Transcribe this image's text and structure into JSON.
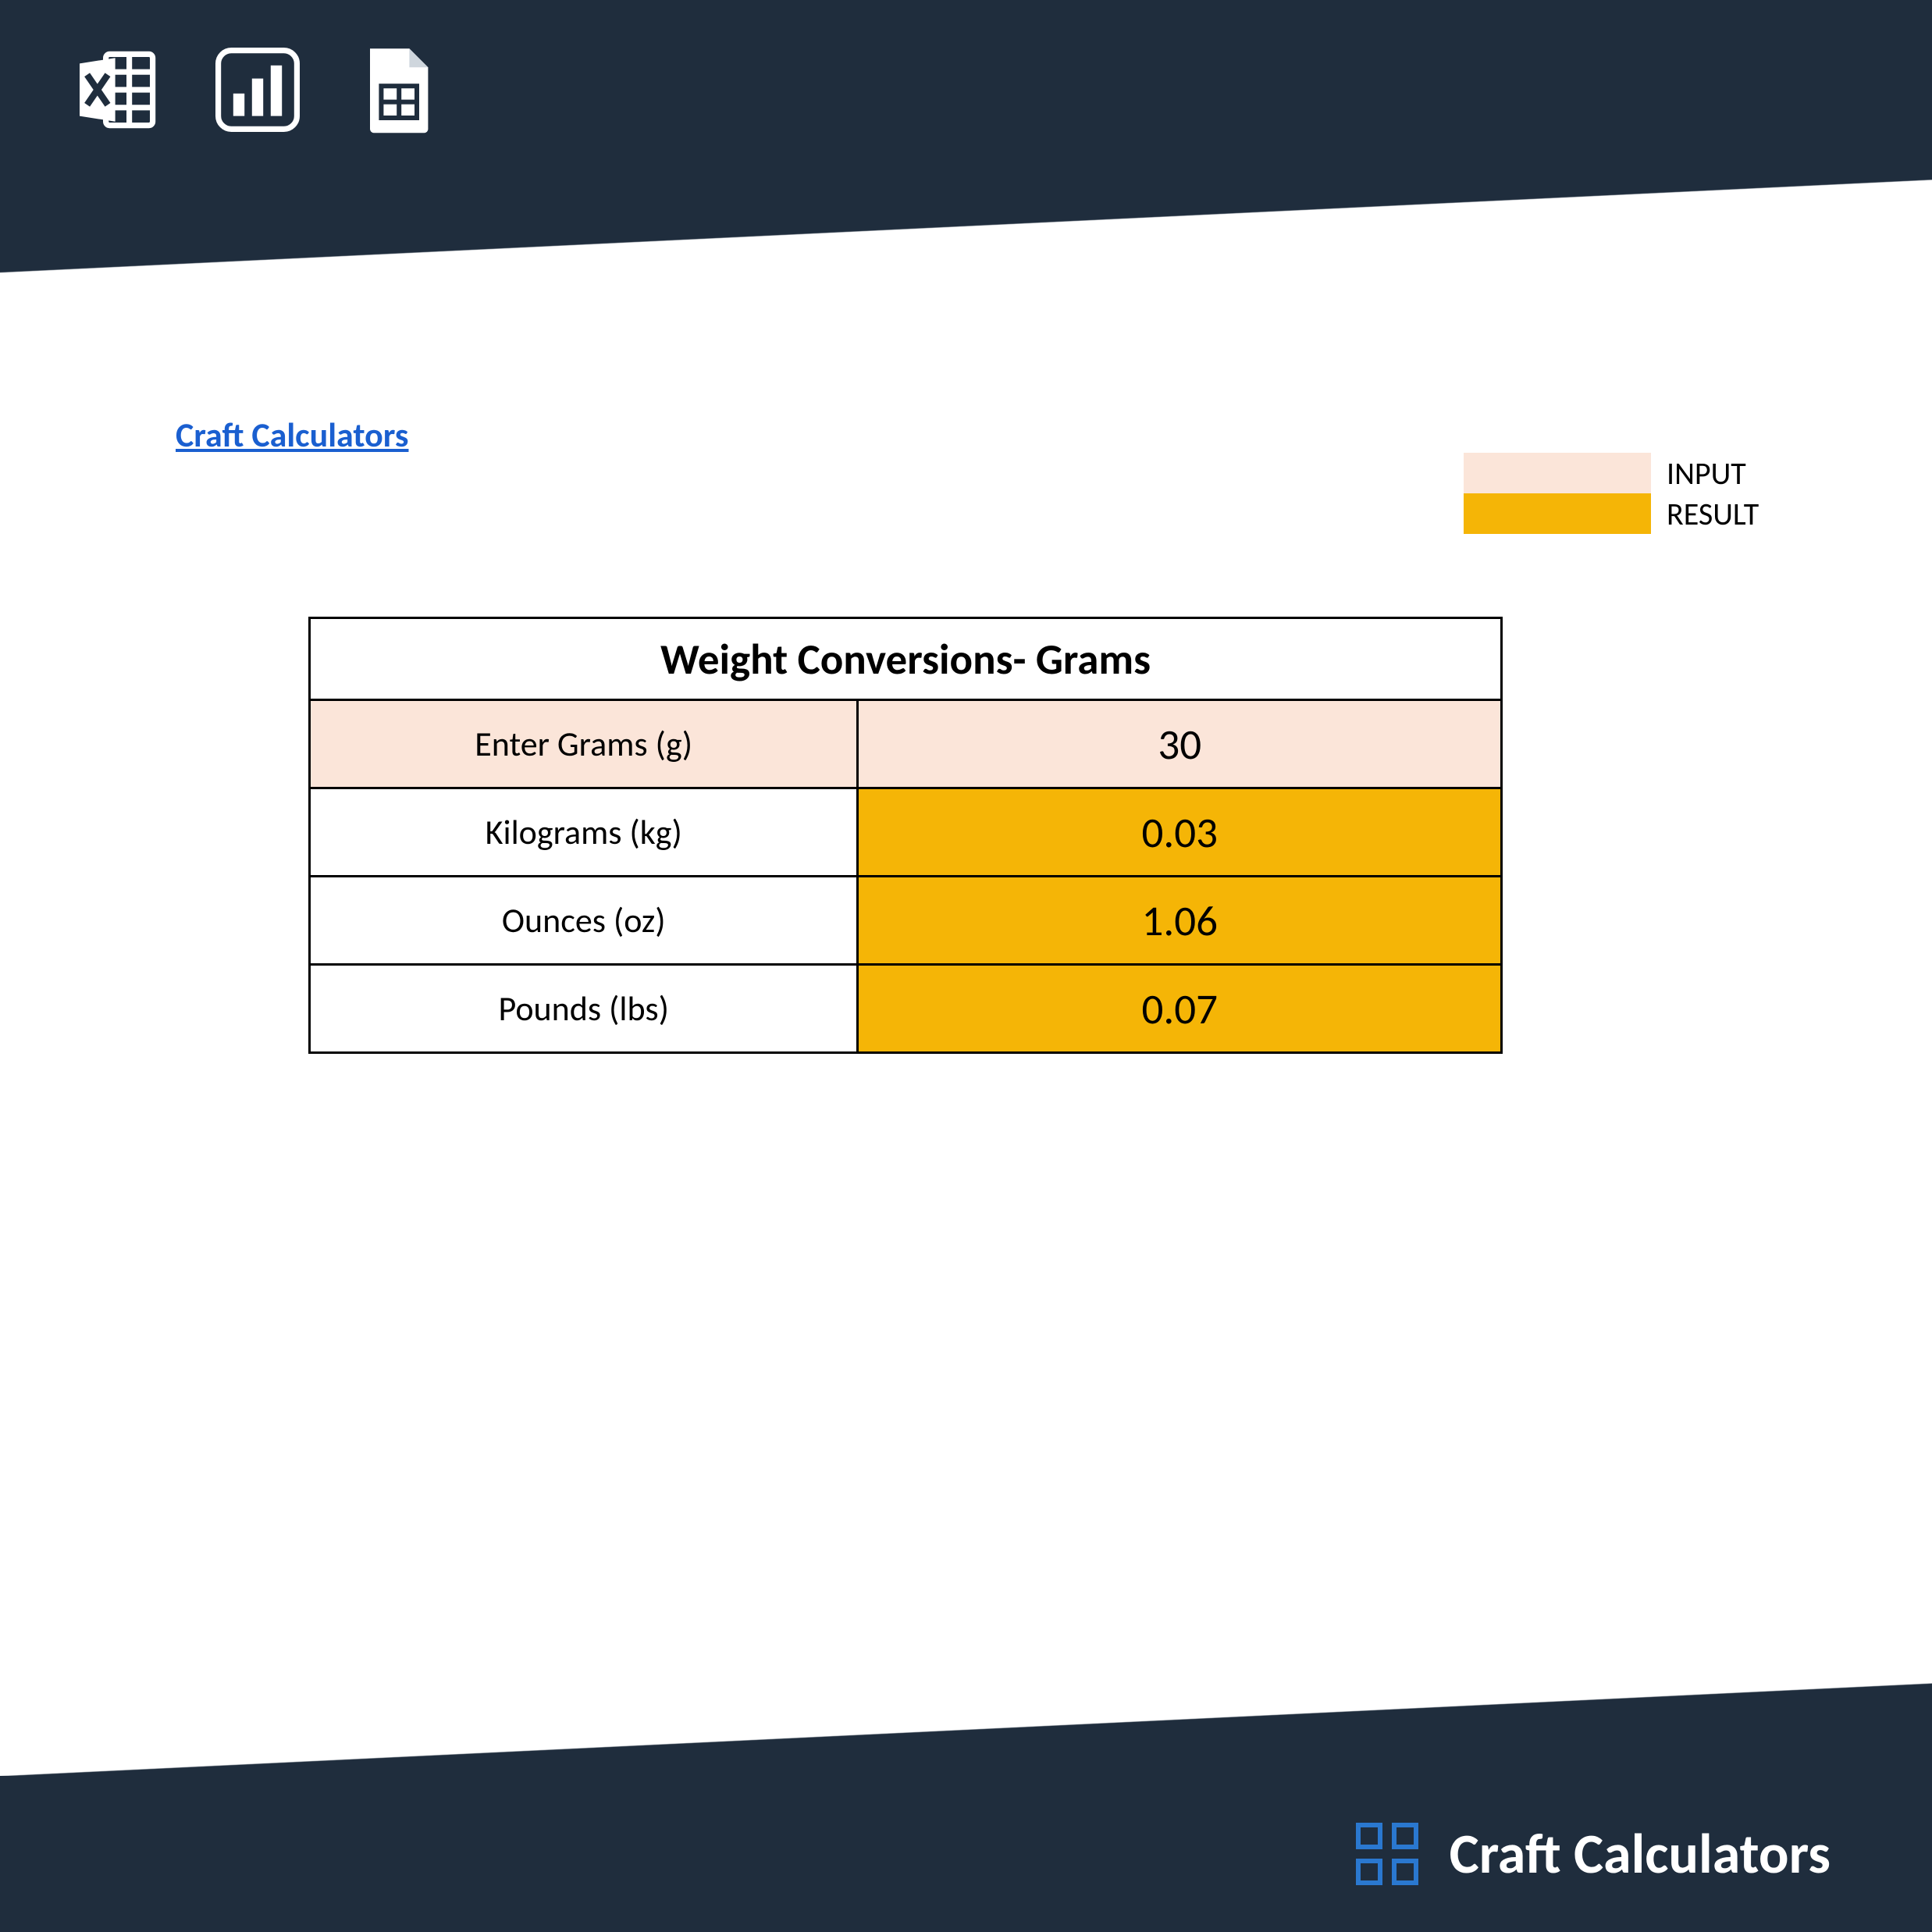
{
  "brand": {
    "link_text": "Craft Calculators",
    "footer_text": "Craft Calculators"
  },
  "legend": {
    "input_label": "INPUT",
    "result_label": "RESULT"
  },
  "table": {
    "title": "Weight Conversions- Grams",
    "rows": [
      {
        "label": "Enter Grams (g)",
        "value": "30",
        "kind": "input"
      },
      {
        "label": "Kilograms (kg)",
        "value": "0.03",
        "kind": "result"
      },
      {
        "label": "Ounces (oz)",
        "value": "1.06",
        "kind": "result"
      },
      {
        "label": "Pounds (lbs)",
        "value": "0.07",
        "kind": "result"
      }
    ]
  },
  "colors": {
    "input_bg": "#fbe5d9",
    "result_bg": "#f5b506",
    "dark": "#1f2d3d",
    "accent": "#2a78d0"
  }
}
